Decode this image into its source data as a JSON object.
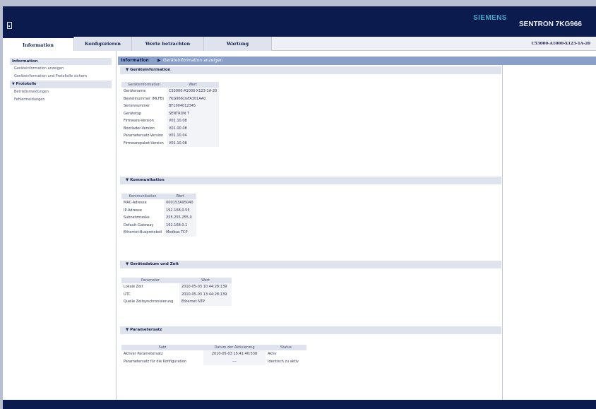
{
  "header": {
    "brand": "SIEMENS",
    "product": "SENTRON 7KG966",
    "device_icon": "device-icon"
  },
  "tabs": [
    {
      "label": "Information",
      "active": true
    },
    {
      "label": "Konfigurieren",
      "active": false
    },
    {
      "label": "Werte betrachten",
      "active": false
    },
    {
      "label": "Wartung",
      "active": false
    }
  ],
  "order_number": "C53000-A1000-X123-1A-20",
  "sidebar": {
    "heading": "Information",
    "items": [
      {
        "label": "Geräteinformation anzeigen",
        "selected": false
      },
      {
        "label": "Geräteinformation und Protokolle sichern",
        "selected": false
      },
      {
        "label": "▼ Protokolle",
        "selected": true
      },
      {
        "label": "Betriebsmeldungen",
        "selected": false
      },
      {
        "label": "Fehlermeldungen",
        "selected": false
      }
    ]
  },
  "breadcrumb": {
    "root": "Information",
    "separator": "▶",
    "current": "Geräteinformation anzeigen"
  },
  "device_info": {
    "title": "▼ Geräteinformation",
    "headers": [
      "Geräteinformation",
      "Wert"
    ],
    "rows": [
      [
        "Gerätename",
        "C53000-A1000-X123-1A-20"
      ],
      [
        "Bestellnummer (MLFB)",
        "7KG9661GFA301AA0"
      ],
      [
        "Seriennummer",
        "BF1004012345"
      ],
      [
        "Gerätetyp",
        "SENTRON T"
      ],
      [
        "Firmware-Version",
        "V01.10.08"
      ],
      [
        "Bootlader-Version",
        "V01.00.08"
      ],
      [
        "Parametersatz-Version",
        "V01.10.04"
      ],
      [
        "Firmwarepaket-Version",
        "V01.10.08"
      ]
    ]
  },
  "communication": {
    "title": "▼ Kommunikation",
    "headers": [
      "Kommunikation",
      "Wert"
    ],
    "rows": [
      [
        "MAC-Adresse",
        "000153A95040"
      ],
      [
        "IP-Adresse",
        "192.168.0.55"
      ],
      [
        "Subnetzmaske",
        "255.255.255.0"
      ],
      [
        "Default-Gateway",
        "192.168.0.1"
      ],
      [
        "Ethernet-Busprotokoll",
        "Modbus TCP"
      ]
    ]
  },
  "datetime": {
    "title": "▼ Gerätedatum und Zeit",
    "headers": [
      "Parameter",
      "Wert"
    ],
    "rows": [
      [
        "Lokale Zeit",
        "2010-05-03 10:44:28:139"
      ],
      [
        "UTC",
        "2010-05-03 13:44:28:139"
      ],
      [
        "Quelle Zeitsynchronisierung",
        "Ethernet NTP"
      ]
    ]
  },
  "paramset": {
    "title": "▼ Parametersatz",
    "headers": [
      "Satz",
      "Datum der Aktivierung",
      "Status"
    ],
    "rows": [
      [
        "Aktiver Parametersatz",
        "2010-05-03 15:41:40:538",
        "Aktiv"
      ],
      [
        "Parametersatz für die Konfiguration",
        "---",
        "Identisch zu aktiv"
      ]
    ]
  }
}
